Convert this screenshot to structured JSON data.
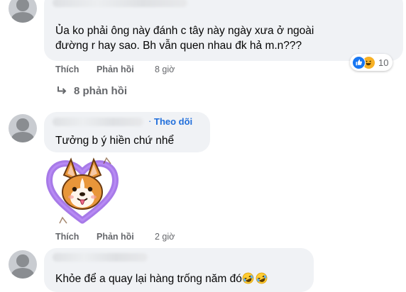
{
  "comments": [
    {
      "text_line1": "Ủa ko phải ông này đánh c tây này ngày xưa ở ngoài",
      "text_line2": "đường r hay sao. Bh vẫn quen nhau đk hả m.n???",
      "like_label": "Thích",
      "reply_label": "Phản hồi",
      "time": "8 giờ",
      "reaction_count": "10",
      "reactions": [
        "like-icon",
        "haha-icon"
      ],
      "replies_label": "8 phản hồi"
    },
    {
      "follow_label": "Theo dõi",
      "text": "Tưởng b ý hiền chứ nhể",
      "sticker": "corgi-heart-sticker",
      "like_label": "Thích",
      "reply_label": "Phản hồi",
      "time": "2 giờ"
    },
    {
      "text": "Khỏe để a quay lại hàng trống năm đó",
      "trailing_emoji": [
        "rofl-emoji",
        "rofl-emoji"
      ]
    }
  ],
  "colors": {
    "bubble": "#f0f2f5",
    "secondary_text": "#65676b",
    "link_blue": "#216fdb",
    "like_blue": "#1877f2",
    "haha_yellow": "#f7b125"
  }
}
